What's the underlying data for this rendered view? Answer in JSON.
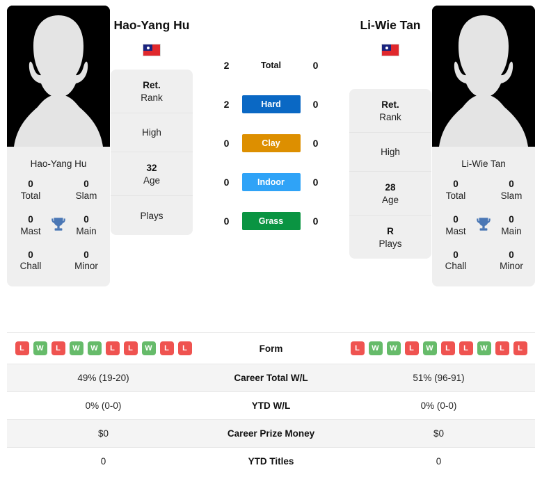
{
  "players": {
    "left": {
      "name": "Hao-Yang Hu",
      "name_under_photo": "Hao-Yang Hu",
      "flag_country": "Taiwan",
      "avatar_icon": "player-silhouette-icon",
      "titles": [
        {
          "num": "0",
          "label": "Total"
        },
        {
          "num": "0",
          "label": "Slam"
        },
        {
          "num": "0",
          "label": "Mast"
        },
        {
          "num": "0",
          "label": "Main"
        },
        {
          "num": "0",
          "label": "Chall"
        },
        {
          "num": "0",
          "label": "Minor"
        }
      ],
      "info": [
        {
          "value": "Ret.",
          "key": "Rank"
        },
        {
          "value": "",
          "key": "High"
        },
        {
          "value": "32",
          "key": "Age"
        },
        {
          "value": "",
          "key": "Plays"
        }
      ],
      "form": [
        "L",
        "W",
        "L",
        "W",
        "W",
        "L",
        "L",
        "W",
        "L",
        "L"
      ],
      "career_total_wl": "49% (19-20)",
      "ytd_wl": "0% (0-0)",
      "career_prize_money": "$0",
      "ytd_titles": "0"
    },
    "right": {
      "name": "Li-Wie Tan",
      "name_under_photo": "Li-Wie Tan",
      "flag_country": "Taiwan",
      "avatar_icon": "player-silhouette-icon",
      "titles": [
        {
          "num": "0",
          "label": "Total"
        },
        {
          "num": "0",
          "label": "Slam"
        },
        {
          "num": "0",
          "label": "Mast"
        },
        {
          "num": "0",
          "label": "Main"
        },
        {
          "num": "0",
          "label": "Chall"
        },
        {
          "num": "0",
          "label": "Minor"
        }
      ],
      "info": [
        {
          "value": "Ret.",
          "key": "Rank"
        },
        {
          "value": "",
          "key": "High"
        },
        {
          "value": "28",
          "key": "Age"
        },
        {
          "value": "R",
          "key": "Plays"
        }
      ],
      "form": [
        "L",
        "W",
        "W",
        "L",
        "W",
        "L",
        "L",
        "W",
        "L",
        "L"
      ],
      "career_total_wl": "51% (96-91)",
      "ytd_wl": "0% (0-0)",
      "career_prize_money": "$0",
      "ytd_titles": "0"
    }
  },
  "head_to_head": [
    {
      "surface": "Total",
      "left": "2",
      "right": "0",
      "color": "",
      "plain": true
    },
    {
      "surface": "Hard",
      "left": "2",
      "right": "0",
      "color": "#0a68c4",
      "plain": false
    },
    {
      "surface": "Clay",
      "left": "0",
      "right": "0",
      "color": "#dd8f00",
      "plain": false
    },
    {
      "surface": "Indoor",
      "left": "0",
      "right": "0",
      "color": "#2fa3f7",
      "plain": false
    },
    {
      "surface": "Grass",
      "left": "0",
      "right": "0",
      "color": "#0a9442",
      "plain": false
    }
  ],
  "stats_rows": [
    {
      "label": "Form",
      "key": "form",
      "type": "form"
    },
    {
      "label": "Career Total W/L",
      "key": "career_total_wl",
      "type": "text"
    },
    {
      "label": "YTD W/L",
      "key": "ytd_wl",
      "type": "text"
    },
    {
      "label": "Career Prize Money",
      "key": "career_prize_money",
      "type": "text"
    },
    {
      "label": "YTD Titles",
      "key": "ytd_titles",
      "type": "text"
    }
  ],
  "colors": {
    "hard": "#0a68c4",
    "clay": "#dd8f00",
    "indoor": "#2fa3f7",
    "grass": "#0a9442",
    "win": "#66bb6a",
    "loss": "#ef5350",
    "trophy": "#4a77b5",
    "card_bg": "#efefef"
  }
}
